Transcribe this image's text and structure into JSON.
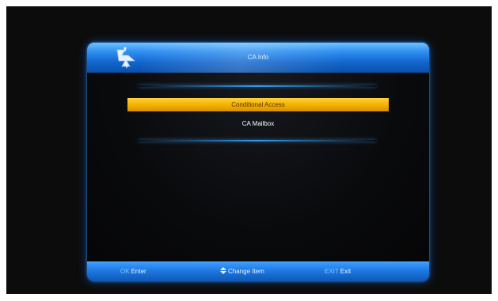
{
  "dialog": {
    "title": "CA Info"
  },
  "menu": {
    "items": [
      {
        "label": "Conditional Access",
        "selected": true
      },
      {
        "label": "CA Mailbox",
        "selected": false
      }
    ]
  },
  "footer": {
    "ok_key": "OK",
    "ok_label": "Enter",
    "change_label": "Change Item",
    "exit_key": "EXIT",
    "exit_label": "Exit"
  },
  "colors": {
    "accent_blue": "#1e78e0",
    "highlight_yellow": "#f4b300",
    "background": "#0c0c0c"
  },
  "icons": {
    "logo": "brand-logo-icon",
    "change": "up-down-arrows-icon"
  }
}
